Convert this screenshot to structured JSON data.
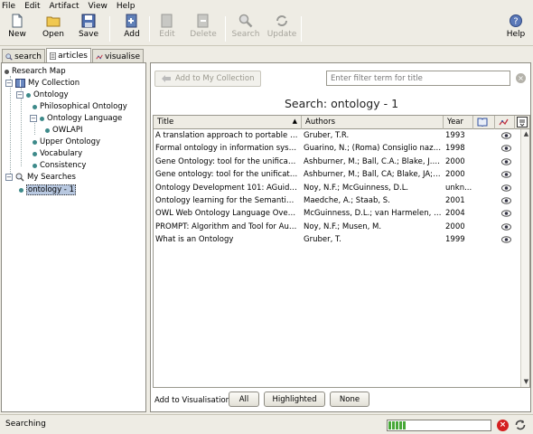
{
  "menubar": {
    "items": [
      "File",
      "Edit",
      "Artifact",
      "View",
      "Help"
    ]
  },
  "toolbar": {
    "new": "New",
    "open": "Open",
    "save": "Save",
    "add": "Add",
    "edit": "Edit",
    "delete": "Delete",
    "search": "Search",
    "update": "Update",
    "help": "Help"
  },
  "tabs": {
    "search": "search",
    "articles": "articles",
    "visualise": "visualise"
  },
  "tree": {
    "root": "Research Map",
    "collection": "My Collection",
    "ontology": "Ontology",
    "philosophical": "Philosophical Ontology",
    "language": "Ontology Language",
    "owlapi": "OWLAPI",
    "upper": "Upper Ontology",
    "vocabulary": "Vocabulary",
    "consistency": "Consistency",
    "searches": "My Searches",
    "search_item": "ontology - 1"
  },
  "right": {
    "add_to_collection": "Add to My Collection",
    "filter_placeholder": "Enter filter term for title",
    "search_title": "Search: ontology - 1"
  },
  "table": {
    "headers": {
      "title": "Title",
      "authors": "Authors",
      "year": "Year"
    },
    "rows": [
      {
        "title": "A translation approach to portable onto...",
        "authors": "Gruber, T.R.",
        "year": "1993"
      },
      {
        "title": "Formal ontology in information systems",
        "authors": "Guarino, N.; (Roma) Consiglio naziona...",
        "year": "1998"
      },
      {
        "title": "Gene Ontology: tool for the unification ...",
        "authors": "Ashburner, M.; Ball, C.A.; Blake, J.A....",
        "year": "2000"
      },
      {
        "title": "Gene ontology: tool for the unification ...",
        "authors": "Ashburner, M.; Ball, CA; Blake, JA; B...",
        "year": "2000"
      },
      {
        "title": "Ontology Development 101: AGuide to ...",
        "authors": "Noy, N.F.; McGuinness, D.L.",
        "year": "unkn..."
      },
      {
        "title": "Ontology learning for the Semantic Web",
        "authors": "Maedche, A.; Staab, S.",
        "year": "2001"
      },
      {
        "title": "OWL Web Ontology Language Overview",
        "authors": "McGuinness, D.L.; van Harmelen, F.; ...",
        "year": "2004"
      },
      {
        "title": "PROMPT: Algorithm and Tool for Autom...",
        "authors": "Noy, N.F.; Musen, M.",
        "year": "2000"
      },
      {
        "title": "What is an Ontology",
        "authors": "Gruber, T.",
        "year": "1999"
      }
    ]
  },
  "visualisation": {
    "label": "Add to Visualisation:",
    "all": "All",
    "highlighted": "Highlighted",
    "none": "None"
  },
  "status": {
    "text": "Searching",
    "progress": 0.18
  },
  "colors": {
    "accent": "#3d8a8a",
    "progress": "#48a838",
    "stop": "#d42020"
  }
}
